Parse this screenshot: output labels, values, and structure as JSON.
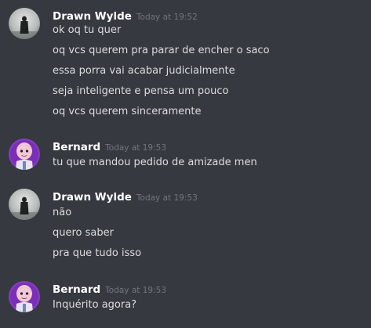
{
  "messages": [
    {
      "author": "Drawn Wylde",
      "timestamp": "Today at 19:52",
      "lines": [
        "ok oq tu quer",
        "oq vcs querem pra parar de encher o saco",
        "essa porra vai acabar judicialmente",
        "seja inteligente e pensa um pouco",
        "oq vcs querem sinceramente"
      ]
    },
    {
      "author": "Bernard",
      "timestamp": "Today at 19:53",
      "lines": [
        "tu que mandou pedido de amizade men"
      ]
    },
    {
      "author": "Drawn Wylde",
      "timestamp": "Today at 19:53",
      "lines": [
        "não",
        "quero saber",
        "pra que tudo isso"
      ]
    },
    {
      "author": "Bernard",
      "timestamp": "Today at 19:53",
      "lines": [
        "Inquérito agora?"
      ]
    }
  ]
}
